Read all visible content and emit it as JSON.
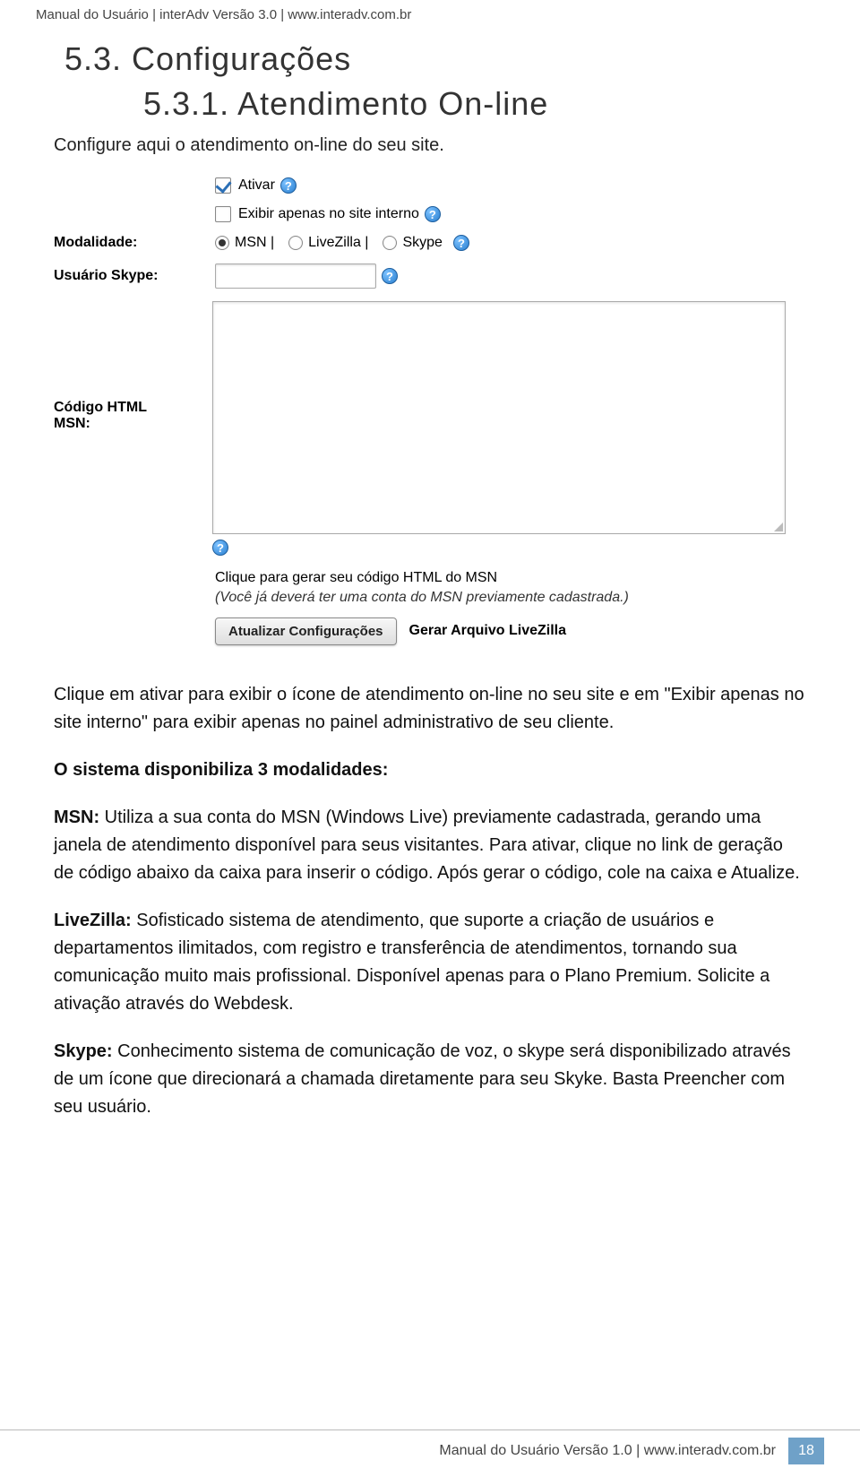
{
  "header": "Manual do Usuário | interAdv Versão 3.0 | www.interadv.com.br",
  "h53": "5.3. Configurações",
  "h531": "5.3.1. Atendimento On-line",
  "intro": "Configure aqui o atendimento on-line do seu site.",
  "ui": {
    "ativar": "Ativar",
    "exibir_interno": "Exibir apenas no site interno",
    "modalidade_label": "Modalidade:",
    "msn": "MSN |",
    "livezilla": "LiveZilla |",
    "skype": "Skype",
    "usuario_skype_label": "Usuário Skype:",
    "codigo_html_label1": "Código HTML",
    "codigo_html_label2": "MSN:",
    "gen_link_line1": "Clique para gerar seu código HTML do MSN",
    "gen_link_line2": "(Você já deverá ter uma conta do MSN previamente cadastrada.)",
    "btn_atualizar": "Atualizar Configurações",
    "link_gerar_livezilla": "Gerar Arquivo LiveZilla"
  },
  "paras": {
    "p1": "Clique em ativar para exibir o ícone de atendimento on-line no seu site e em \"Exibir apenas no site interno\" para exibir apenas no painel administrativo de seu cliente.",
    "p2_lead": "O sistema disponibiliza 3 modalidades:",
    "msn_label": "MSN:",
    "msn_text": " Utiliza a sua conta do MSN (Windows Live) previamente cadastrada, gerando uma janela de atendimento disponível para seus visitantes. Para ativar, clique no link de geração de código abaixo da caixa para inserir o código. Após gerar o código, cole na caixa e Atualize.",
    "lz_label": "LiveZilla:",
    "lz_text": " Sofisticado sistema de atendimento, que suporte a criação de usuários e departamentos ilimitados, com registro e transferência de atendimentos, tornando sua comunicação muito mais profissional. Disponível apenas para o Plano Premium. Solicite a ativação através do Webdesk.",
    "sk_label": "Skype:",
    "sk_text": " Conhecimento sistema de comunicação de voz, o skype será disponibilizado através de um ícone que direcionará a chamada diretamente para seu Skyke. Basta Preencher com seu usuário."
  },
  "footer": {
    "text": "Manual do Usuário Versão 1.0 | www.interadv.com.br",
    "page": "18"
  }
}
